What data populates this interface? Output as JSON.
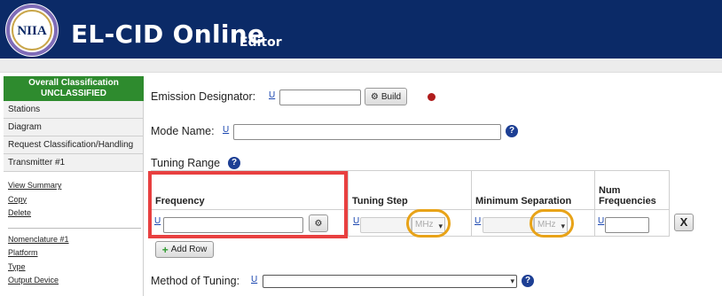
{
  "header": {
    "logo_text": "NIIA",
    "title": "EL-CID Online",
    "subtitle": "Editor"
  },
  "sidebar": {
    "classification_label": "Overall Classification",
    "classification_value": "UNCLASSIFIED",
    "nav": [
      "Stations",
      "Diagram",
      "Request Classification/Handling",
      "Transmitter #1"
    ],
    "links_top": [
      "View Summary",
      "Copy",
      "Delete"
    ],
    "links_bottom": [
      "Nomenclature #1",
      "Platform",
      "Type",
      "Output Device"
    ]
  },
  "form": {
    "emission_label": "Emission Designator:",
    "u": "U",
    "build_label": "Build",
    "mode_label": "Mode Name:",
    "tuning_label": "Tuning Range",
    "help": "?",
    "columns": {
      "frequency": "Frequency",
      "tuning_step": "Tuning Step",
      "minimum_separation": "Minimum Separation",
      "num_frequencies": "Num Frequencies"
    },
    "unit_tuning": "MHz",
    "unit_separation": "MHz",
    "add_row_label": "Add Row",
    "method_label": "Method of Tuning:",
    "delete_glyph": "X"
  },
  "colors": {
    "header_bg": "#0b2a67",
    "classification_bg": "#2e8b2e",
    "highlight_red": "#e84040",
    "highlight_orange": "#e8a318"
  }
}
